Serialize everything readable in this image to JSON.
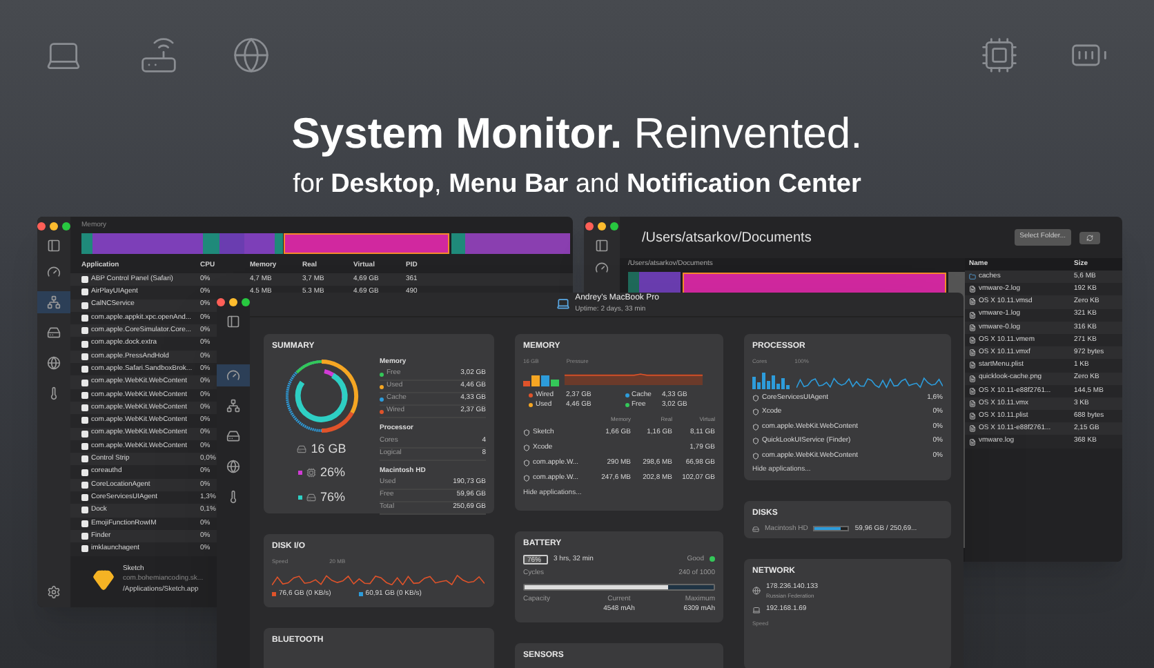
{
  "hero": {
    "title_bold": "System Monitor.",
    "title_rest": "Reinvented.",
    "subtitle": "for **Desktop**, **Menu Bar** and **Notification Center**"
  },
  "memory_window": {
    "title": "Memory",
    "sidebar": [
      {
        "kind": "gauge",
        "selected": false
      },
      {
        "kind": "network",
        "selected": true
      },
      {
        "kind": "drive",
        "selected": false
      },
      {
        "kind": "globe",
        "selected": false
      },
      {
        "kind": "thermometer",
        "selected": false
      }
    ],
    "columns": [
      "Application",
      "CPU",
      "Memory",
      "Real",
      "Virtual",
      "PID"
    ],
    "rows": [
      {
        "name": "ABP Control Panel (Safari)",
        "cpu": "0%",
        "memory": "4,7 MB",
        "real": "3,7 MB",
        "virtual": "4,69 GB",
        "pid": "361"
      },
      {
        "name": "AirPlayUIAgent",
        "cpu": "0%",
        "memory": "4,5 MB",
        "real": "5,3 MB",
        "virtual": "4,69 GB",
        "pid": "490"
      },
      {
        "name": "CalNCService",
        "cpu": "0%"
      },
      {
        "name": "com.apple.appkit.xpc.openAnd...",
        "cpu": "0%"
      },
      {
        "name": "com.apple.CoreSimulator.Core...",
        "cpu": "0%"
      },
      {
        "name": "com.apple.dock.extra",
        "cpu": "0%"
      },
      {
        "name": "com.apple.PressAndHold",
        "cpu": "0%"
      },
      {
        "name": "com.apple.Safari.SandboxBrok...",
        "cpu": "0%"
      },
      {
        "name": "com.apple.WebKit.WebContent",
        "cpu": "0%"
      },
      {
        "name": "com.apple.WebKit.WebContent",
        "cpu": "0%"
      },
      {
        "name": "com.apple.WebKit.WebContent",
        "cpu": "0%"
      },
      {
        "name": "com.apple.WebKit.WebContent",
        "cpu": "0%"
      },
      {
        "name": "com.apple.WebKit.WebContent",
        "cpu": "0%"
      },
      {
        "name": "com.apple.WebKit.WebContent",
        "cpu": "0%"
      },
      {
        "name": "Control Strip",
        "cpu": "0,0%"
      },
      {
        "name": "coreauthd",
        "cpu": "0%"
      },
      {
        "name": "CoreLocationAgent",
        "cpu": "0%"
      },
      {
        "name": "CoreServicesUIAgent",
        "cpu": "1,3%"
      },
      {
        "name": "Dock",
        "cpu": "0,1%"
      },
      {
        "name": "EmojiFunctionRowIM",
        "cpu": "0%"
      },
      {
        "name": "Finder",
        "cpu": "0%"
      },
      {
        "name": "imklaunchagent",
        "cpu": "0%"
      }
    ],
    "footer": {
      "name": "Sketch",
      "bundle": "com.bohemiancoding.sk...",
      "path": "/Applications/Sketch.app"
    }
  },
  "disk_window": {
    "title": "/Users/atsarkov/Documents",
    "select_button": "Select Folder...",
    "breadcrumb": "/Users/atsarkov/Documents",
    "columns": [
      "Name",
      "Size"
    ],
    "files": [
      {
        "kind": "folder",
        "name": "caches",
        "size": "5,6 MB"
      },
      {
        "kind": "file",
        "name": "vmware-2.log",
        "size": "192 KB"
      },
      {
        "kind": "file",
        "name": "OS X 10.11.vmsd",
        "size": "Zero KB"
      },
      {
        "kind": "file",
        "name": "vmware-1.log",
        "size": "321 KB"
      },
      {
        "kind": "file",
        "name": "vmware-0.log",
        "size": "316 KB"
      },
      {
        "kind": "file",
        "name": "OS X 10.11.vmem",
        "size": "271 KB"
      },
      {
        "kind": "file",
        "name": "OS X 10.11.vmxf",
        "size": "972 bytes"
      },
      {
        "kind": "file",
        "name": "startMenu.plist",
        "size": "1 KB"
      },
      {
        "kind": "file",
        "name": "quicklook-cache.png",
        "size": "Zero KB"
      },
      {
        "kind": "file",
        "name": "OS X 10.11-e88f2761...",
        "size": "144,5 MB"
      },
      {
        "kind": "file",
        "name": "OS X 10.11.vmx",
        "size": "3 KB"
      },
      {
        "kind": "file",
        "name": "OS X 10.11.plist",
        "size": "688 bytes"
      },
      {
        "kind": "file",
        "name": "OS X 10.11-e88f2761...",
        "size": "2,15 GB"
      },
      {
        "kind": "file",
        "name": "vmware.log",
        "size": "368 KB"
      }
    ]
  },
  "main_window": {
    "machine": "Andrey's MacBook Pro",
    "uptime": "Uptime: 2 days, 33 min",
    "sidebar": [
      {
        "kind": "gauge",
        "selected": true
      },
      {
        "kind": "network",
        "selected": false
      },
      {
        "kind": "drive",
        "selected": false
      },
      {
        "kind": "globe",
        "selected": false
      },
      {
        "kind": "thermometer",
        "selected": false
      }
    ],
    "summary": {
      "title": "SUMMARY",
      "total": "16 GB",
      "used_pct": "26%",
      "disk_pct": "76%",
      "groups": [
        {
          "title": "Memory",
          "items": [
            {
              "label": "Free",
              "value": "3,02 GB",
              "color": "#34c759"
            },
            {
              "label": "Used",
              "value": "4,46 GB",
              "color": "#f5a623"
            },
            {
              "label": "Cache",
              "value": "4,33 GB",
              "color": "#2d9cdb"
            },
            {
              "label": "Wired",
              "value": "2,37 GB",
              "color": "#e0532a"
            }
          ]
        },
        {
          "title": "Processor",
          "items": [
            {
              "label": "Cores",
              "value": "4"
            },
            {
              "label": "Logical",
              "value": "8"
            }
          ]
        },
        {
          "title": "Macintosh HD",
          "items": [
            {
              "label": "Used",
              "value": "190,73 GB"
            },
            {
              "label": "Free",
              "value": "59,96 GB"
            },
            {
              "label": "Total",
              "value": "250,69 GB"
            }
          ]
        }
      ]
    },
    "memory": {
      "title": "MEMORY",
      "scale": "16 GB",
      "pressure": "Pressure",
      "legend": [
        {
          "label": "Wired",
          "value": "2,37 GB",
          "color": "#e0532a"
        },
        {
          "label": "Cache",
          "value": "4,33 GB",
          "color": "#2d9cdb"
        },
        {
          "label": "Used",
          "value": "4,46 GB",
          "color": "#f5a623"
        },
        {
          "label": "Free",
          "value": "3,02 GB",
          "color": "#34c759"
        }
      ],
      "columns": [
        "Memory",
        "Real",
        "Virtual"
      ],
      "apps": [
        {
          "name": "Sketch",
          "memory": "1,66 GB",
          "real": "1,16 GB",
          "virtual": "8,11 GB"
        },
        {
          "name": "Xcode",
          "virtual": "1,79 GB"
        },
        {
          "name": "com.apple.W...",
          "memory": "290 MB",
          "real": "298,6 MB",
          "virtual": "66,98 GB"
        },
        {
          "name": "com.apple.W...",
          "memory": "247,6 MB",
          "real": "202,8 MB",
          "virtual": "102,07 GB"
        }
      ],
      "hide": "Hide applications..."
    },
    "processor": {
      "title": "PROCESSOR",
      "cores": "Cores",
      "scale": "100%",
      "apps": [
        {
          "name": "CoreServicesUIAgent",
          "value": "1,6%"
        },
        {
          "name": "Xcode",
          "value": "0%"
        },
        {
          "name": "com.apple.WebKit.WebContent",
          "value": "0%"
        },
        {
          "name": "QuickLookUIService (Finder)",
          "value": "0%"
        },
        {
          "name": "com.apple.WebKit.WebContent",
          "value": "0%"
        }
      ],
      "hide": "Hide applications..."
    },
    "disk_io": {
      "title": "DISK I/O",
      "speed": "Speed",
      "scale": "20 MB",
      "read": "76,6 GB (0 KB/s)",
      "write": "60,91 GB (0 KB/s)"
    },
    "battery": {
      "title": "BATTERY",
      "percent": "76%",
      "level": 0.76,
      "time": "3 hrs, 32 min",
      "health": "Good",
      "cycles_label": "Cycles",
      "cycles": "240 of 1000",
      "cycles_bar": {
        "level": 0.76
      },
      "capacity": "Capacity",
      "current_label": "Current",
      "current": "4548 mAh",
      "maximum_label": "Maximum",
      "maximum": "6309 mAh"
    },
    "disks": {
      "title": "DISKS",
      "name": "Macintosh HD",
      "level": 0.76,
      "value": "59,96 GB / 250,69..."
    },
    "network": {
      "title": "NETWORK",
      "addresses": [
        {
          "kind": "globe",
          "ip": "178.236.140.133",
          "sub": "Russian Federation"
        },
        {
          "kind": "laptop",
          "ip": "192.168.1.69"
        }
      ],
      "speed": "Speed"
    },
    "bluetooth": {
      "title": "BLUETOOTH"
    },
    "sensors": {
      "title": "SENSORS"
    }
  }
}
